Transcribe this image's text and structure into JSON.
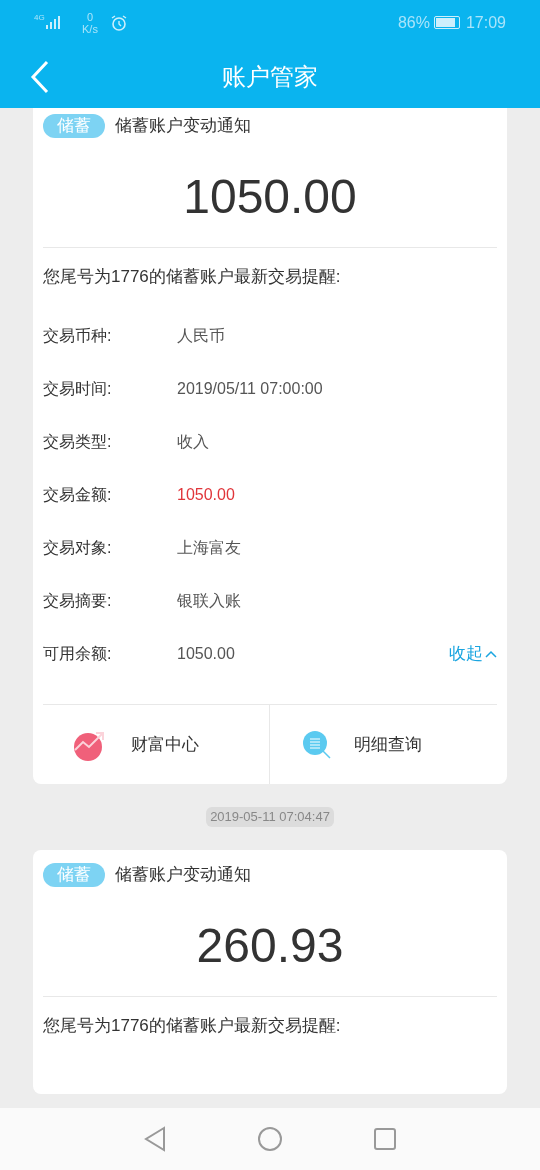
{
  "status_bar": {
    "network": "4G",
    "speed_value": "0",
    "speed_unit": "K/s",
    "battery": "86%",
    "time": "17:09"
  },
  "header": {
    "title": "账户管家"
  },
  "feed": [
    {
      "kind": "card",
      "tag": "储蓄",
      "title": "储蓄账户变动通知",
      "amount": "1050.00",
      "reminder": "您尾号为1776的储蓄账户最新交易提醒:",
      "details": [
        {
          "label": "交易币种:",
          "value": "人民币",
          "highlight": false
        },
        {
          "label": "交易时间:",
          "value": "2019/05/11 07:00:00",
          "highlight": false
        },
        {
          "label": "交易类型:",
          "value": "收入",
          "highlight": false
        },
        {
          "label": "交易金额:",
          "value": "1050.00",
          "highlight": true
        },
        {
          "label": "交易对象:",
          "value": "上海富友",
          "highlight": false
        },
        {
          "label": "交易摘要:",
          "value": "银联入账",
          "highlight": false
        },
        {
          "label": "可用余额:",
          "value": "1050.00",
          "highlight": false
        }
      ],
      "collapse": "收起",
      "actions": [
        {
          "label": "财富中心",
          "kind": "wealth"
        },
        {
          "label": "明细查询",
          "kind": "search"
        }
      ]
    },
    {
      "kind": "timestamp",
      "text": "2019-05-11 07:04:47"
    },
    {
      "kind": "card",
      "tag": "储蓄",
      "title": "储蓄账户变动通知",
      "amount": "260.93",
      "reminder": "您尾号为1776的储蓄账户最新交易提醒:"
    }
  ]
}
